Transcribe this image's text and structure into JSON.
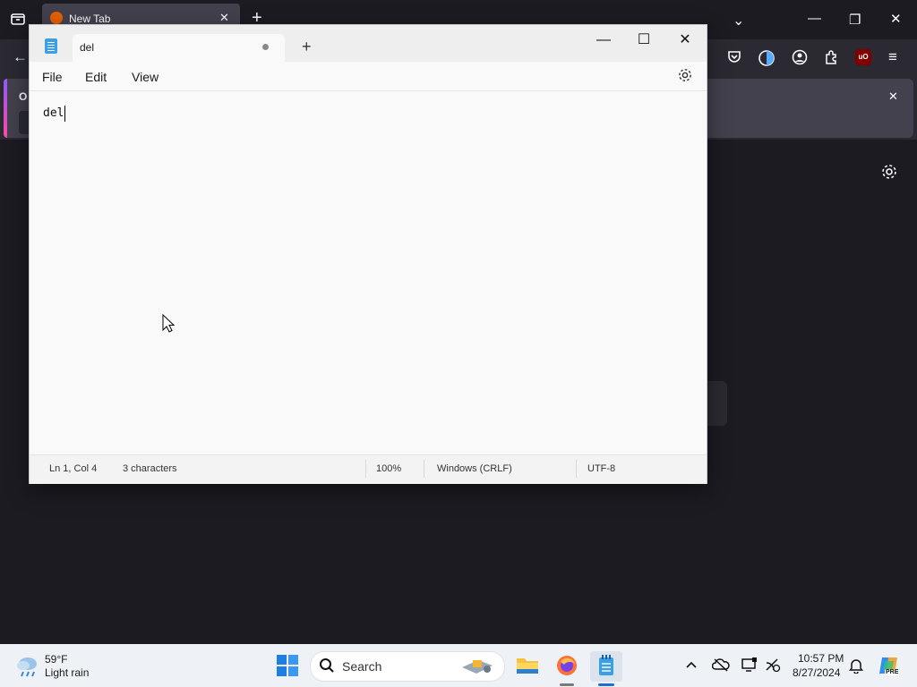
{
  "firefox": {
    "tab_title": "New Tab",
    "tab_close": "✕",
    "new_tab": "+",
    "notification_prefix": "O",
    "notification_close": "✕",
    "icons": [
      "tab-list-icon",
      "back-icon",
      "pocket-icon",
      "sync-icon",
      "account-icon",
      "extensions-icon",
      "ublock-icon",
      "menu-icon",
      "settings-icon"
    ],
    "ublock_label": "uO",
    "window_controls": {
      "minimize": "—",
      "restore": "❐",
      "close": "✕",
      "chevron": "⌄"
    }
  },
  "notepad": {
    "tab_title": "del",
    "new_tab": "+",
    "window_controls": {
      "minimize": "—",
      "maximize": "☐",
      "close": "✕"
    },
    "menu": {
      "file": "File",
      "edit": "Edit",
      "view": "View"
    },
    "content": "del",
    "status": {
      "position": "Ln 1, Col 4",
      "characters": "3 characters",
      "zoom": "100%",
      "line_ending": "Windows (CRLF)",
      "encoding": "UTF-8"
    }
  },
  "taskbar": {
    "weather": {
      "temp": "59°F",
      "condition": "Light rain"
    },
    "search_placeholder": "Search",
    "clock": {
      "time": "10:57 PM",
      "date": "8/27/2024"
    },
    "tray_icons": [
      "chevron-up-icon",
      "onedrive-icon",
      "display-icon",
      "network-icon",
      "notification-bell-icon",
      "copilot-icon"
    ],
    "copilot_badge": "PRE",
    "apps": [
      "start-icon",
      "file-explorer-icon",
      "firefox-icon",
      "notepad-icon"
    ]
  }
}
